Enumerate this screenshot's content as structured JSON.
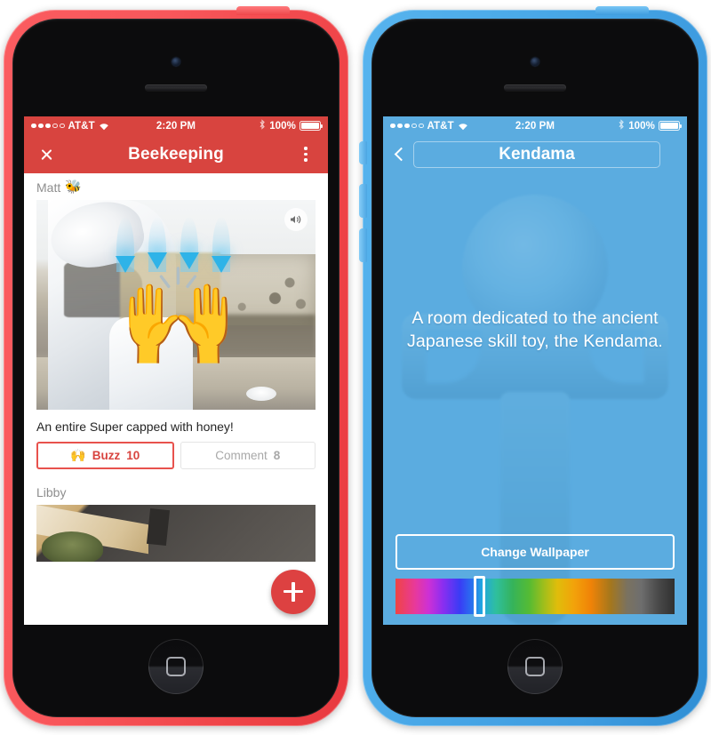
{
  "left_phone": {
    "device_color_name": "coral",
    "status_bar": {
      "signal_filled": 3,
      "signal_empty": 2,
      "carrier": "AT&T",
      "wifi_icon": "wifi-icon",
      "time": "2:20 PM",
      "bluetooth_icon": "bluetooth-icon",
      "battery_percent": "100%",
      "battery_level": 100
    },
    "navbar": {
      "close_icon": "close-icon",
      "title": "Beekeeping",
      "overflow_icon": "overflow-menu-icon"
    },
    "feed": {
      "posts": [
        {
          "author": "Matt",
          "author_emoji": "🐝",
          "media_overlay_emoji": "🙌",
          "mute_icon": "speaker-icon",
          "caption": "An entire Super capped with honey!",
          "buzz_icon": "raised-hands-icon",
          "buzz_label": "Buzz",
          "buzz_count": "10",
          "comment_label": "Comment",
          "comment_count": "8"
        },
        {
          "author": "Libby"
        }
      ],
      "fab_icon": "plus-icon"
    },
    "accent_color": "#d8443f"
  },
  "right_phone": {
    "device_color_name": "azure",
    "status_bar": {
      "signal_filled": 3,
      "signal_empty": 2,
      "carrier": "AT&T",
      "wifi_icon": "wifi-icon",
      "time": "2:20 PM",
      "bluetooth_icon": "bluetooth-icon",
      "battery_percent": "100%",
      "battery_level": 100
    },
    "navbar": {
      "back_icon": "back-chevron-icon",
      "title": "Kendama"
    },
    "room": {
      "background_icon": "kendama-silhouette",
      "description": "A room dedicated to the ancient Japanese skill toy, the Kendama.",
      "change_wallpaper_label": "Change Wallpaper",
      "color_slider": {
        "name": "color-slider",
        "handle_position_percent": 28
      }
    },
    "accent_color": "#5bace0"
  }
}
